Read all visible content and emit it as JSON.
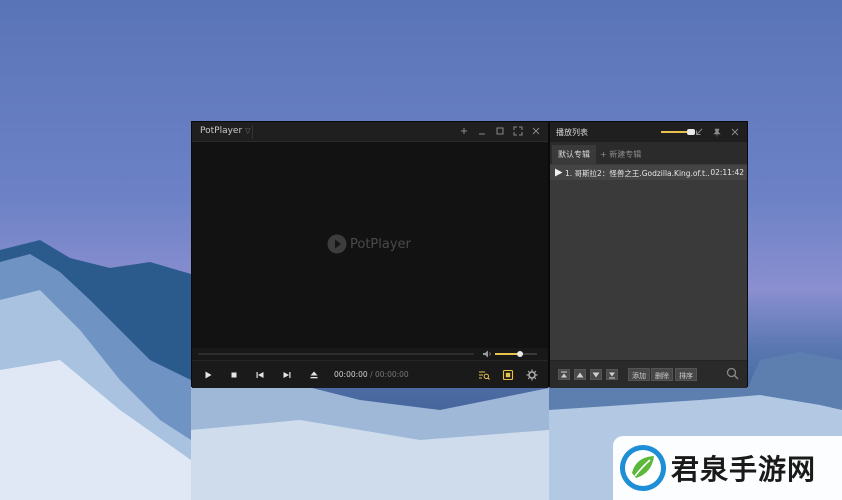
{
  "player": {
    "brand": "PotPlayer",
    "watermark": "PotPlayer",
    "time_current": "00:00:00",
    "time_sep": "/",
    "time_total": "00:00:00",
    "volume_level": 0.6,
    "accent_color": "#e8c24a"
  },
  "playlist": {
    "title": "播放列表",
    "tabs": [
      {
        "label": "默认专辑",
        "active": true
      },
      {
        "label": "+ 新建专辑",
        "active": false
      }
    ],
    "items": [
      {
        "index": "1.",
        "name": "哥斯拉2：怪兽之王.Godzilla.King.of.t...",
        "duration": "02:11:42"
      }
    ],
    "actions": {
      "add": "添加",
      "delete": "删除",
      "sort": "排序"
    }
  },
  "site_logo": {
    "name": "君泉手游网"
  }
}
